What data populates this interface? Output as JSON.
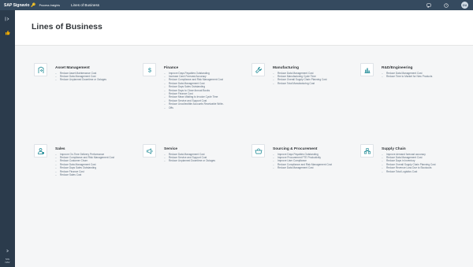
{
  "shell": {
    "brand": "SAP Signavio",
    "brand_sub": "Process Insights",
    "title": "Lines of Business",
    "avatar_initials": "OU"
  },
  "rail": {
    "footer_line1": "SIG",
    "footer_line2": "NAV"
  },
  "page": {
    "title": "Lines of Business"
  },
  "cards": [
    {
      "title": "Asset Management",
      "icon": "asset-icon",
      "items": [
        "Reduce Asset Maintenance Cost",
        "Reduce Data Management Cost",
        "Reduce Unplanned Downtime or Outages"
      ]
    },
    {
      "title": "Finance",
      "icon": "dollar-icon",
      "items": [
        "Improve Days Payables Outstanding",
        "Increase Cash Forecast Accuracy",
        "Reduce Compliance and Risk Management Cost",
        "Reduce Data Management Cost",
        "Reduce Days Sales Outstanding",
        "Reduce Days to Close Annual Books",
        "Reduce Finance Cost",
        "Reduce Mean Waiting to Invoice Cycle Time",
        "Reduce Service and Support Cost",
        "Reduce Uncollectible Accounts Receivable Write-",
        "Offs"
      ]
    },
    {
      "title": "Manufacturing",
      "icon": "wrench-icon",
      "items": [
        "Reduce Data Management Cost",
        "Reduce Manufacturing Cycle Time",
        "Reduce Overall Supply Chain Planning Cost",
        "Reduce Total Manufacturing Cost"
      ]
    },
    {
      "title": "R&D/Engineering",
      "icon": "chart-bars-icon",
      "items": [
        "Reduce Data Management Cost",
        "Reduce Time to Market for New Products"
      ]
    },
    {
      "title": "Sales",
      "icon": "person-icon",
      "items": [
        "Improve On-Time Delivery Performance",
        "Reduce Compliance and Risk Management Cost",
        "Reduce Customer Churn",
        "Reduce Data Management Cost",
        "Reduce Days Sales Outstanding",
        "Reduce Finance Cost",
        "Reduce Sales Cost"
      ]
    },
    {
      "title": "Service",
      "icon": "megaphone-icon",
      "items": [
        "Reduce Data Management Cost",
        "Reduce Service and Support Cost",
        "Reduce Unplanned Downtime or Outages"
      ]
    },
    {
      "title": "Sourcing & Procurement",
      "icon": "basket-icon",
      "items": [
        "Improve Days Payables Outstanding",
        "Improve Procurement FTE Productivity",
        "Improve User Compliance",
        "Reduce Compliance and Risk Management Cost",
        "Reduce Data Management Cost"
      ]
    },
    {
      "title": "Supply Chain",
      "icon": "supply-chain-icon",
      "items": [
        "Improve demand forecast accuracy",
        "Reduce Data Management Cost",
        "Reduce Days in Inventory",
        "Reduce Overall Supply Chain Planning Cost",
        "Reduce Revenue Loss Due to Stockouts",
        "Reduce Total Logistics Cost"
      ]
    }
  ],
  "colors": {
    "shell_bg": "#354a5f",
    "rail_bg": "#2b3b4c",
    "accent": "#0a6ed1",
    "icon_teal": "#0f828f"
  }
}
